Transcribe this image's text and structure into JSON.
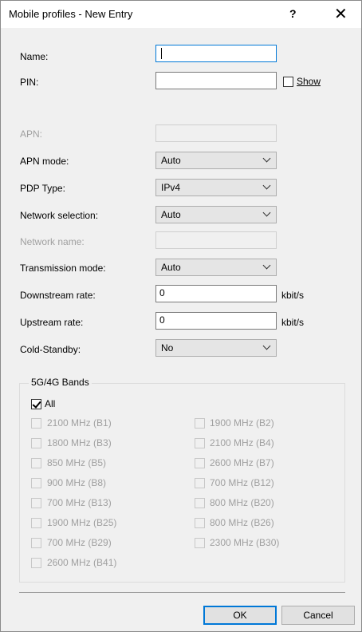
{
  "window": {
    "title": "Mobile profiles - New Entry",
    "help_label": "?",
    "close_label": "✕"
  },
  "fields": {
    "name": {
      "label": "Name:",
      "value": ""
    },
    "pin": {
      "label": "PIN:",
      "value": "",
      "show_label": "Show",
      "show_checked": false
    },
    "apn": {
      "label": "APN:",
      "value": ""
    },
    "apn_mode": {
      "label": "APN mode:",
      "value": "Auto"
    },
    "pdp_type": {
      "label": "PDP Type:",
      "value": "IPv4"
    },
    "network_selection": {
      "label": "Network selection:",
      "value": "Auto"
    },
    "network_name": {
      "label": "Network name:",
      "value": ""
    },
    "transmission_mode": {
      "label": "Transmission mode:",
      "value": "Auto"
    },
    "downstream_rate": {
      "label": "Downstream rate:",
      "value": "0",
      "unit": "kbit/s"
    },
    "upstream_rate": {
      "label": "Upstream rate:",
      "value": "0",
      "unit": "kbit/s"
    },
    "cold_standby": {
      "label": "Cold-Standby:",
      "value": "No"
    }
  },
  "bands": {
    "title": "5G/4G Bands",
    "all_label": "All",
    "all_checked": true,
    "left": [
      "2100 MHz (B1)",
      "1800 MHz (B3)",
      "850 MHz (B5)",
      "900 MHz (B8)",
      "700 MHz (B13)",
      "1900 MHz (B25)",
      "700 MHz (B29)",
      "2600 MHz (B41)"
    ],
    "right": [
      "1900 MHz (B2)",
      "2100 MHz (B4)",
      "2600 MHz (B7)",
      "700 MHz (B12)",
      "800 MHz (B20)",
      "800 MHz (B26)",
      "2300 MHz (B30)"
    ]
  },
  "buttons": {
    "ok": "OK",
    "cancel": "Cancel"
  },
  "colors": {
    "accent": "#0078d7",
    "disabled_text": "#a0a0a0"
  }
}
